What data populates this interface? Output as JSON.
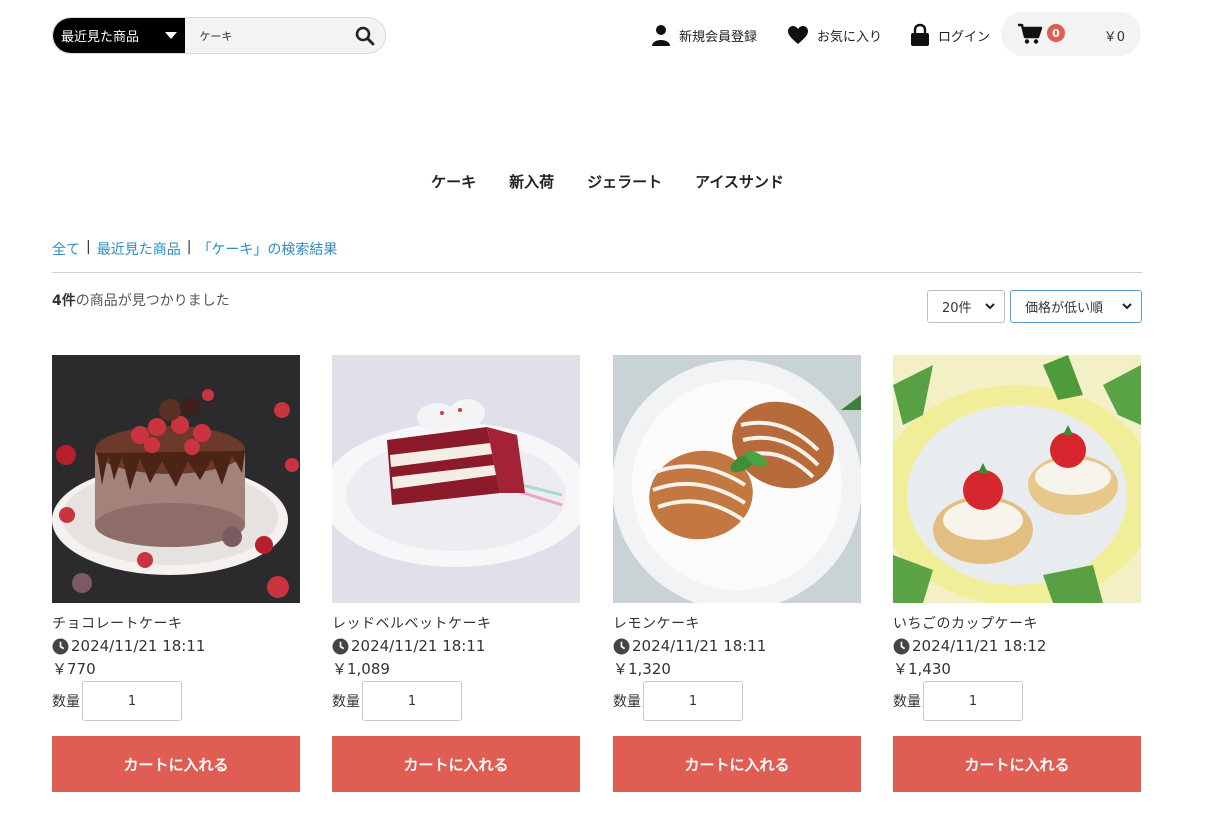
{
  "header": {
    "search_category": "最近見た商品",
    "search_value": "ケーキ",
    "register_label": "新規会員登録",
    "favorites_label": "お気に入り",
    "login_label": "ログイン",
    "cart_count": "0",
    "cart_total": "￥0"
  },
  "nav": {
    "categories": [
      {
        "label": "ケーキ"
      },
      {
        "label": "新入荷"
      },
      {
        "label": "ジェラート"
      },
      {
        "label": "アイスサンド"
      }
    ]
  },
  "breadcrumb": {
    "all": "全て",
    "sep": "|",
    "recent": "最近見た商品",
    "query": "「ケーキ」の検索結果"
  },
  "results": {
    "count": "4件",
    "suffix": "の商品が見つかりました",
    "per_page": "20件",
    "sort": "価格が低い順"
  },
  "products": [
    {
      "name": "チョコレートケーキ",
      "date": "2024/11/21 18:11",
      "price": "￥770",
      "qty_label": "数量",
      "qty": "1",
      "button": "カートに入れる"
    },
    {
      "name": "レッドベルベットケーキ",
      "date": "2024/11/21 18:11",
      "price": "￥1,089",
      "qty_label": "数量",
      "qty": "1",
      "button": "カートに入れる"
    },
    {
      "name": "レモンケーキ",
      "date": "2024/11/21 18:11",
      "price": "￥1,320",
      "qty_label": "数量",
      "qty": "1",
      "button": "カートに入れる"
    },
    {
      "name": "いちごのカップケーキ",
      "date": "2024/11/21 18:12",
      "price": "￥1,430",
      "qty_label": "数量",
      "qty": "1",
      "button": "カートに入れる"
    }
  ],
  "colors": {
    "accent": "#e05d53",
    "link": "#2a8fc0",
    "search_category_bg": "#000000"
  }
}
